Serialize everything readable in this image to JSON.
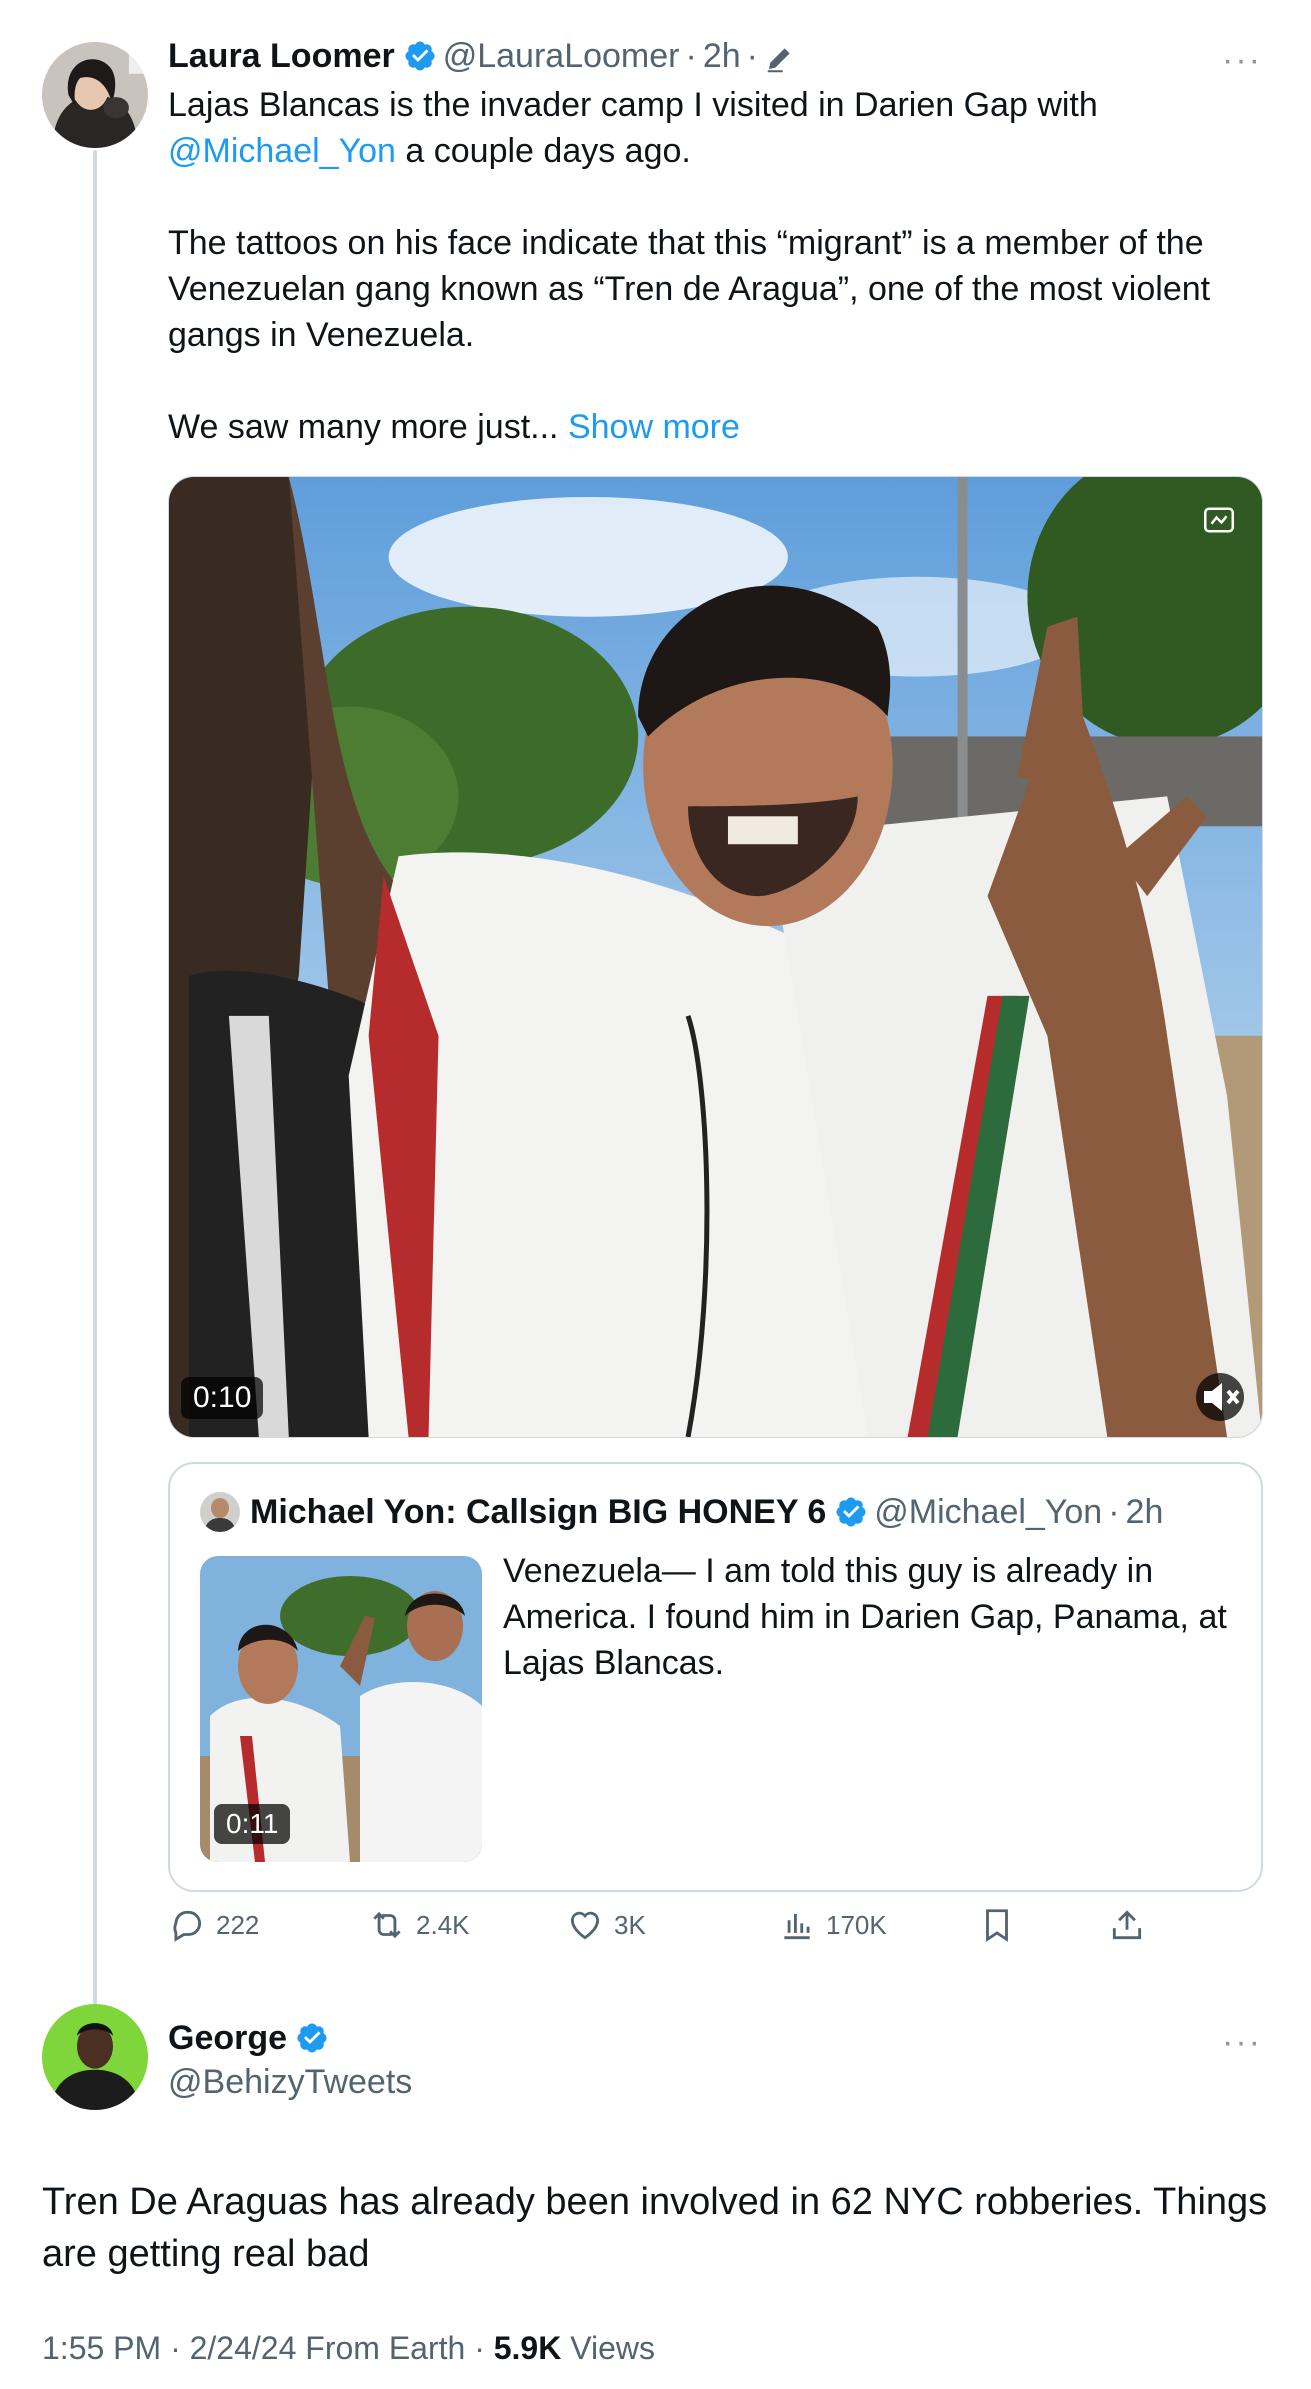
{
  "colors": {
    "link": "#1d9bf0",
    "verified": "#1d9bf0",
    "muted_text": "#536471",
    "thread_line": "#cfd9de"
  },
  "tweet1": {
    "display_name": "Laura Loomer",
    "handle": "@LauraLoomer",
    "time": "2h",
    "edited_icon": "pencil-icon",
    "paragraph1_before": "Lajas Blancas is the invader camp I visited in Darien Gap with ",
    "mention": "@Michael_Yon",
    "paragraph1_after": " a couple days ago.",
    "paragraph2": "The tattoos on his face indicate that this “migrant” is a member of the Venezuelan gang known as “Tren de Aragua”, one of the most violent gangs in Venezuela.",
    "paragraph3": "We saw many more just...",
    "show_more": "Show more",
    "video_duration": "0:10",
    "quote": {
      "display_name": "Michael Yon: Callsign BIG HONEY 6",
      "handle": "@Michael_Yon",
      "time": "2h",
      "text": "Venezuela— I am told this guy is already in America.  I found him in Darien Gap, Panama, at Lajas Blancas.",
      "video_duration": "0:11"
    },
    "stats": {
      "replies": "222",
      "reposts": "2.4K",
      "likes": "3K",
      "views": "170K"
    }
  },
  "tweet2": {
    "display_name": "George",
    "handle": "@BehizyTweets",
    "text": "Tren De Araguas has already been involved in 62 NYC robberies. Things are getting real bad",
    "time": "1:55 PM",
    "date": "2/24/24",
    "source": "From Earth",
    "views_count": "5.9K",
    "views_label": "Views"
  }
}
